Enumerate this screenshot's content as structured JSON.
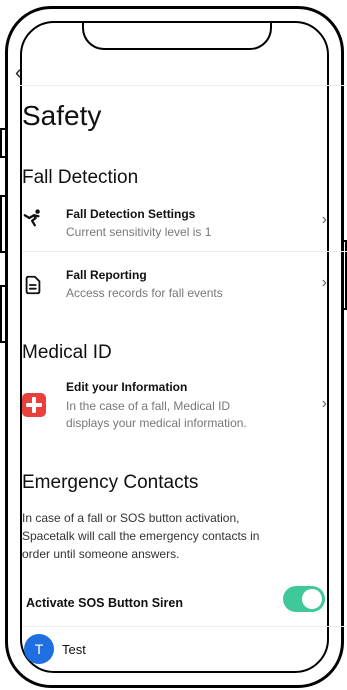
{
  "nav": {
    "back_glyph": "‹"
  },
  "page": {
    "title": "Safety"
  },
  "fall_detection": {
    "heading": "Fall Detection",
    "settings": {
      "title": "Fall Detection Settings",
      "subtitle": "Current sensitivity level is 1",
      "icon": "falling-person-icon"
    },
    "reporting": {
      "title": "Fall Reporting",
      "subtitle": "Access records for fall events",
      "icon": "document-icon"
    }
  },
  "medical_id": {
    "heading": "Medical ID",
    "edit": {
      "title": "Edit your Information",
      "subtitle_line1": "In the case of a fall, Medical ID",
      "subtitle_line2": "displays your medical information.",
      "icon": "medical-cross-icon",
      "icon_color": "#e8413c"
    }
  },
  "emergency_contacts": {
    "heading": "Emergency Contacts",
    "description_line1": "In case of a fall or SOS button activation,",
    "description_line2": "Spacetalk will call the emergency contacts in",
    "description_line3": "order until someone answers.",
    "sos_siren_label": "Activate SOS Button Siren",
    "sos_siren_on": true,
    "toggle_color": "#3fc99a",
    "contacts": [
      {
        "initial": "T",
        "name": "Test",
        "avatar_color": "#1f6fe0"
      }
    ]
  },
  "chevron_glyph": "›"
}
